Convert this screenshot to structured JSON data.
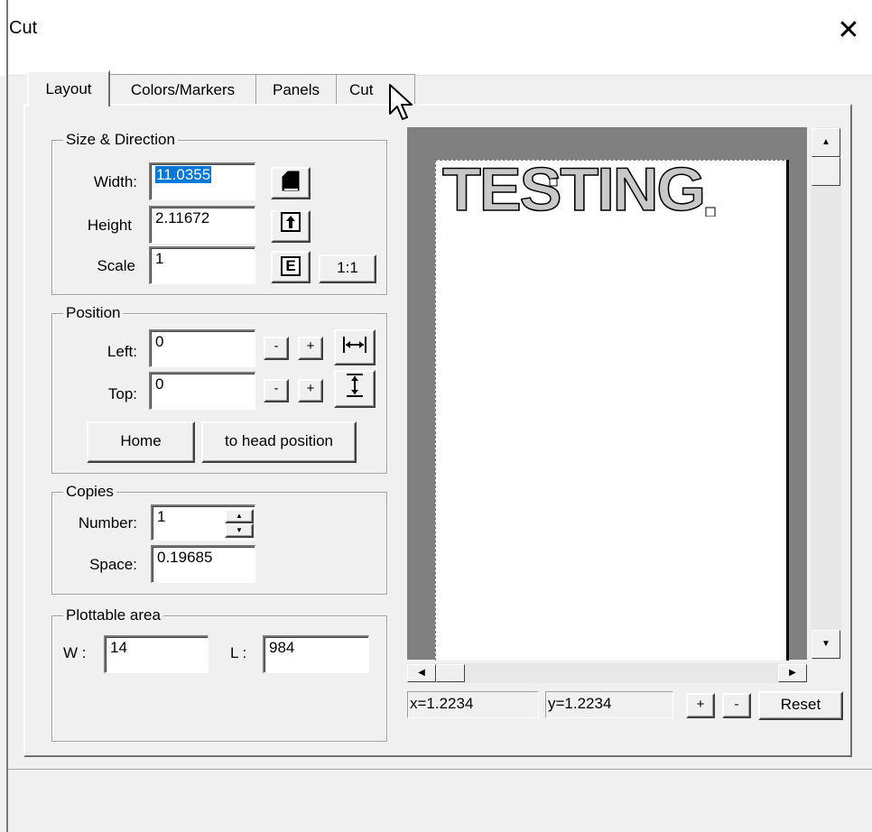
{
  "window": {
    "title": "Cut",
    "close_glyph": "✕"
  },
  "tabs": [
    {
      "label": "Layout",
      "active": true
    },
    {
      "label": "Colors/Markers",
      "active": false
    },
    {
      "label": "Panels",
      "active": false
    },
    {
      "label": "Cut",
      "active": false
    }
  ],
  "size_direction": {
    "legend": "Size & Direction",
    "width_label": "Width:",
    "width_value": "11.0355",
    "height_label": "Height",
    "height_value": "2.11672",
    "scale_label": "Scale",
    "scale_value": "1",
    "scale_icon_glyph": "E",
    "one_to_one_label": "1:1"
  },
  "position": {
    "legend": "Position",
    "left_label": "Left:",
    "left_value": "0",
    "top_label": "Top:",
    "top_value": "0",
    "minus": "-",
    "plus": "+",
    "home_label": "Home",
    "head_label": "to head position"
  },
  "copies": {
    "legend": "Copies",
    "number_label": "Number:",
    "number_value": "1",
    "space_label": "Space:",
    "space_value": "0.19685"
  },
  "plottable": {
    "legend": "Plottable area",
    "w_label": "W :",
    "w_value": "14",
    "l_label": "L :",
    "l_value": "984"
  },
  "preview": {
    "text": "TESTING",
    "x_readout": "x=1.2234",
    "y_readout": "y=1.2234",
    "zoom_in": "+",
    "zoom_out": "-",
    "reset_label": "Reset"
  }
}
